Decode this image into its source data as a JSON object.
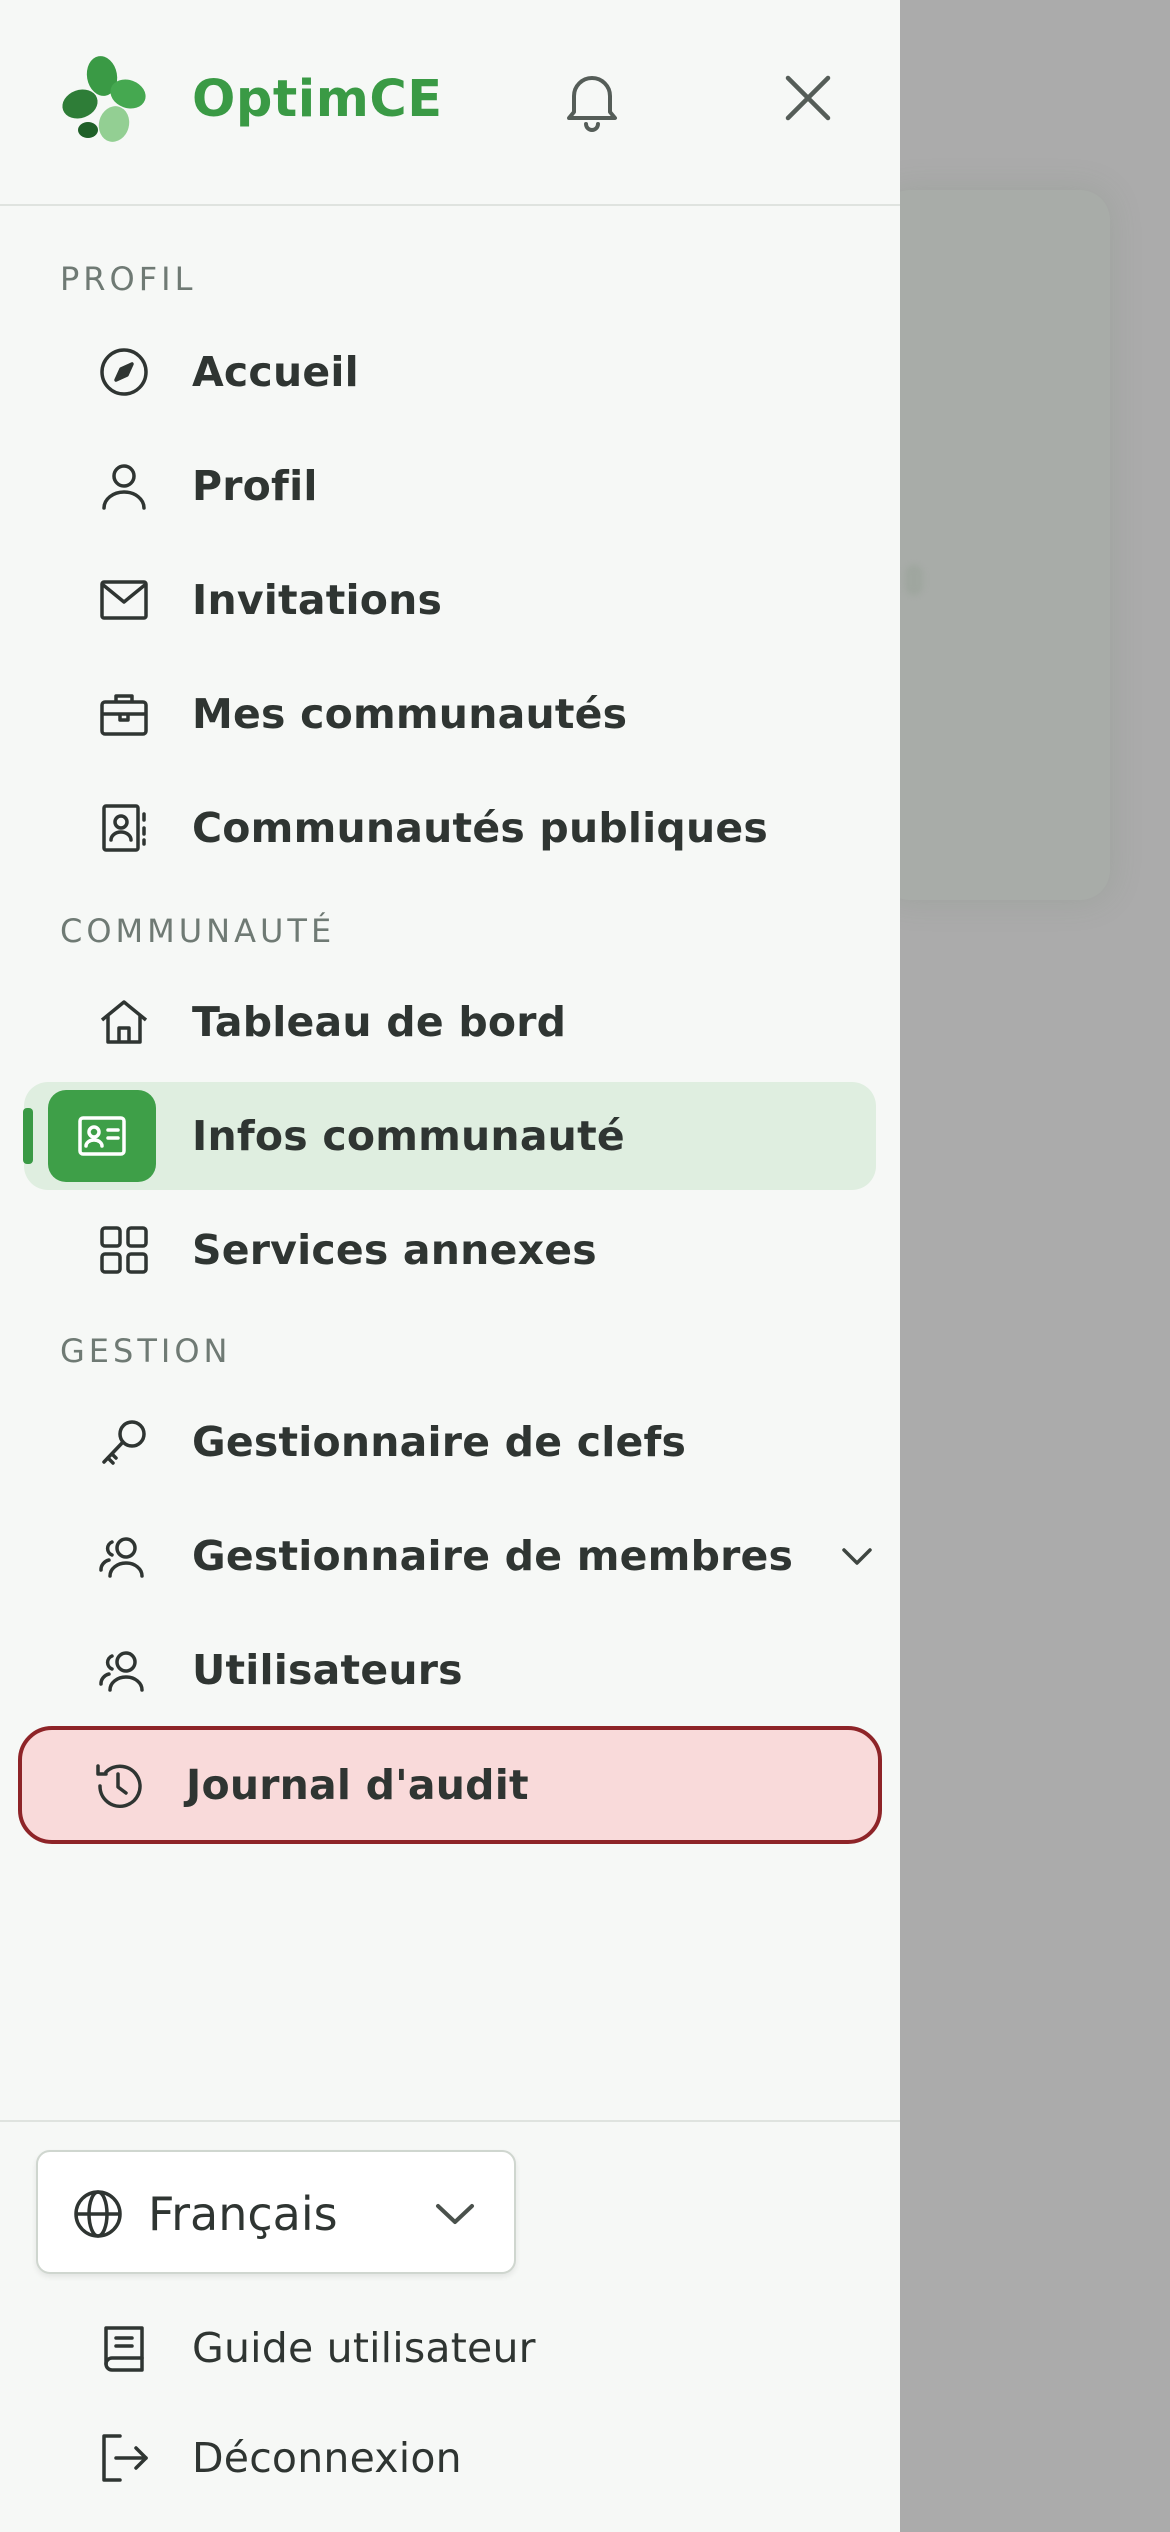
{
  "app": {
    "brand": "OptimCE",
    "accent_color": "#3a9a45"
  },
  "header": {
    "notification_icon": "bell-icon",
    "close_icon": "close-icon"
  },
  "sections": {
    "profil": "PROFIL",
    "communaute": "COMMUNAUTÉ",
    "gestion": "GESTION"
  },
  "nav": {
    "accueil": "Accueil",
    "profil": "Profil",
    "invitations": "Invitations",
    "mes_communautes": "Mes communautés",
    "communautes_publiques": "Communautés publiques",
    "tableau_de_bord": "Tableau de bord",
    "infos_communaute": "Infos communauté",
    "services_annexes": "Services annexes",
    "gestionnaire_clefs": "Gestionnaire de clefs",
    "gestionnaire_membres": "Gestionnaire de membres",
    "utilisateurs": "Utilisateurs",
    "journal_audit": "Journal d'audit"
  },
  "footer": {
    "language": "Français",
    "guide": "Guide utilisateur",
    "logout": "Déconnexion"
  }
}
